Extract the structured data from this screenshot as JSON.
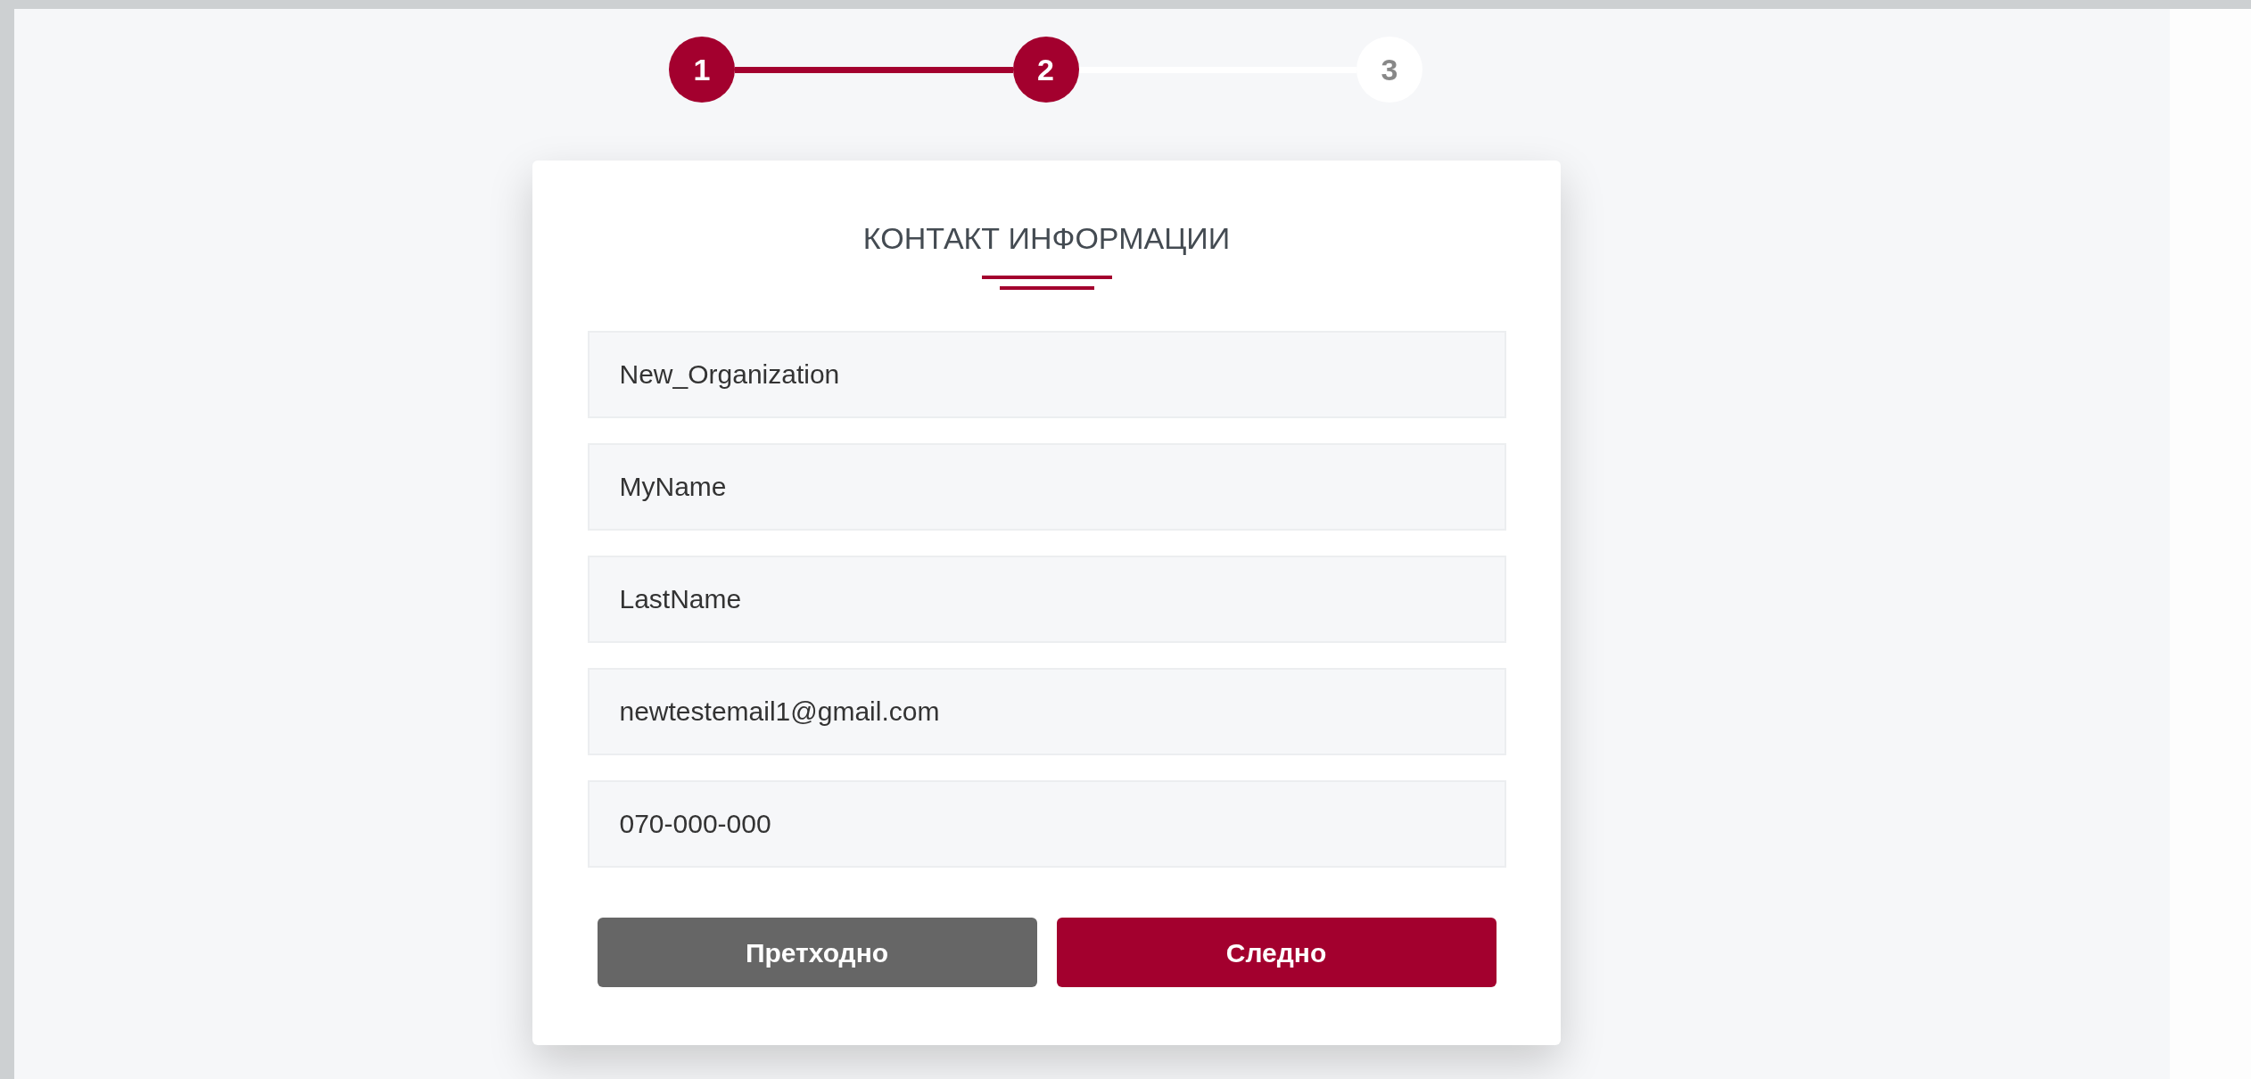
{
  "steps": [
    {
      "label": "1",
      "reached": true
    },
    {
      "label": "2",
      "reached": true
    },
    {
      "label": "3",
      "reached": false
    }
  ],
  "card": {
    "title": "КОНТАКТ ИНФОРМАЦИИ",
    "fields": [
      {
        "value": "New_Organization"
      },
      {
        "value": "MyName"
      },
      {
        "value": "LastName"
      },
      {
        "value": "newtestemail1@gmail.com"
      },
      {
        "value": "070-000-000"
      }
    ],
    "buttons": [
      {
        "label": "Претходно",
        "kind": "back"
      },
      {
        "label": "Следно",
        "kind": "next"
      }
    ]
  }
}
